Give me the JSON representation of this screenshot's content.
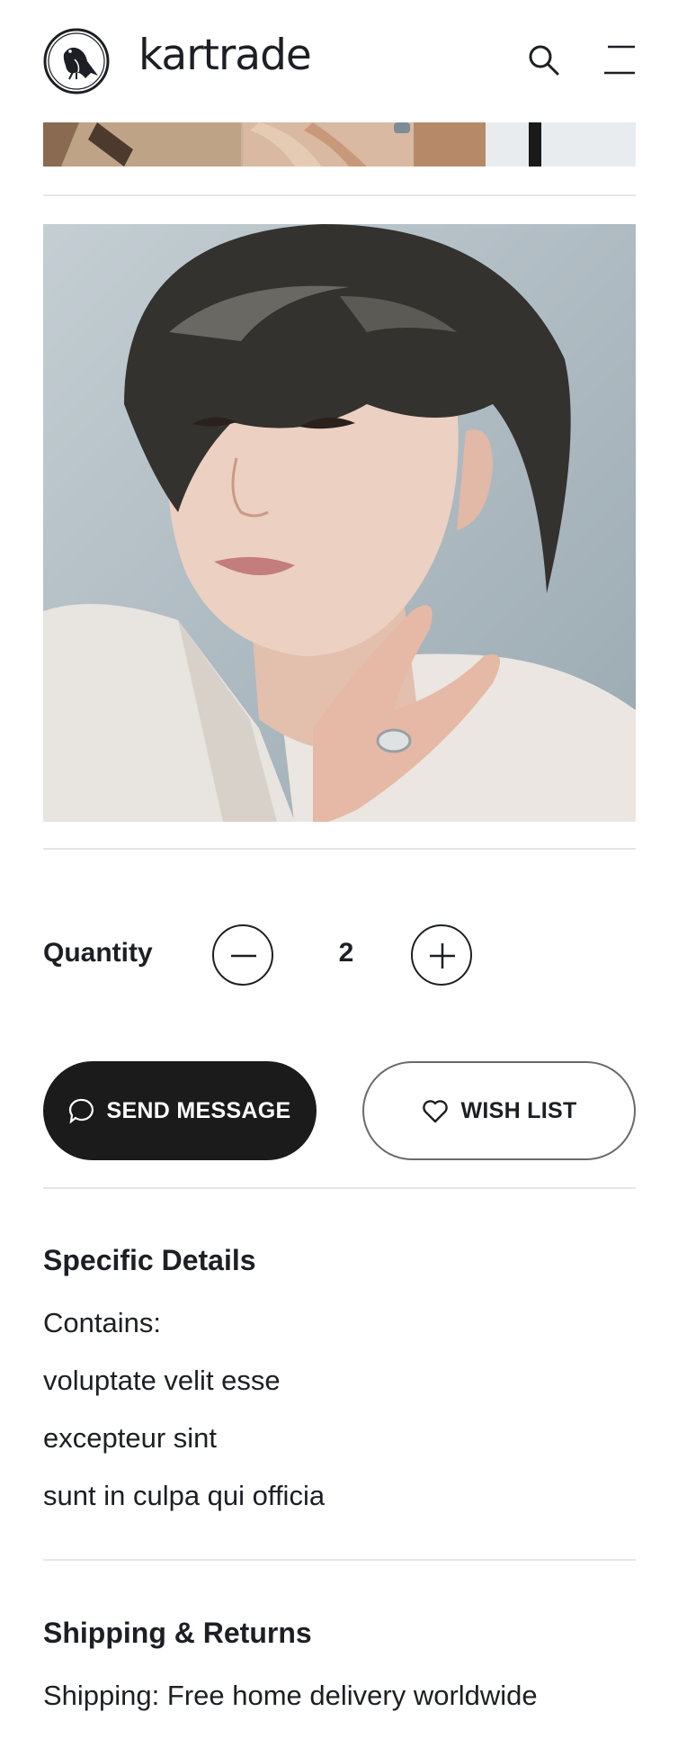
{
  "header": {
    "brand": "kartrade",
    "logo_icon": "magpie-bird-logo",
    "search_icon": "search-icon",
    "menu_icon": "menu-icon"
  },
  "gallery": {
    "top_image_alt": "product photo (partial, scrolled)",
    "main_image_alt": "photocard portrait"
  },
  "quantity": {
    "label": "Quantity",
    "value": "2",
    "decrement_icon": "minus-icon",
    "increment_icon": "plus-icon"
  },
  "actions": {
    "send_message_label": "SEND MESSAGE",
    "wish_list_label": "WISH LIST",
    "message_icon": "chat-bubble-icon",
    "wish_icon": "heart-icon"
  },
  "details": {
    "title": "Specific Details",
    "lines": [
      "Contains:",
      "voluptate velit esse",
      "excepteur sint",
      "sunt in culpa qui officia"
    ]
  },
  "shipping": {
    "title": "Shipping & Returns",
    "line": "Shipping: Free home delivery worldwide"
  },
  "colors": {
    "text": "#1d1f24",
    "button_dark": "#1b1b1b",
    "separator": "#e6e6e6"
  }
}
